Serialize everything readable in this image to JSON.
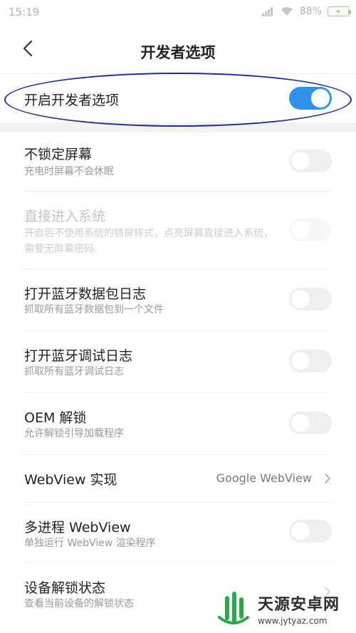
{
  "status_bar": {
    "time": "15:19",
    "battery": "88%"
  },
  "app_bar": {
    "title": "开发者选项"
  },
  "master_toggle": {
    "label": "开启开发者选项",
    "on": true
  },
  "rows": [
    {
      "label": "不锁定屏幕",
      "sub": "充电时屏幕不会休眠",
      "on": false
    },
    {
      "label": "直接进入系统",
      "sub": "开启后不使用系统的锁屏样式，点亮屏幕直接进入系统，需要无屏幕密码",
      "on": false,
      "disabled": true
    },
    {
      "label": "打开蓝牙数据包日志",
      "sub": "抓取所有蓝牙数据包到一个文件",
      "on": false
    },
    {
      "label": "打开蓝牙调试日志",
      "sub": "抓取所有蓝牙调试日志",
      "on": false
    },
    {
      "label": "OEM 解锁",
      "sub": "允许解锁引导加载程序",
      "on": false
    },
    {
      "label": "WebView 实现",
      "value": "Google WebView"
    },
    {
      "label": "多进程 WebView",
      "sub": "单独运行 WebView 渲染程序",
      "on": false
    },
    {
      "label": "设备解锁状态",
      "sub": "查看当前设备的解锁状态"
    }
  ],
  "watermark": {
    "name": "天源安卓网",
    "url": "www.jytyaz.com"
  },
  "colors": {
    "accent": "#2f91ea",
    "annotation": "#1f2a9e"
  }
}
